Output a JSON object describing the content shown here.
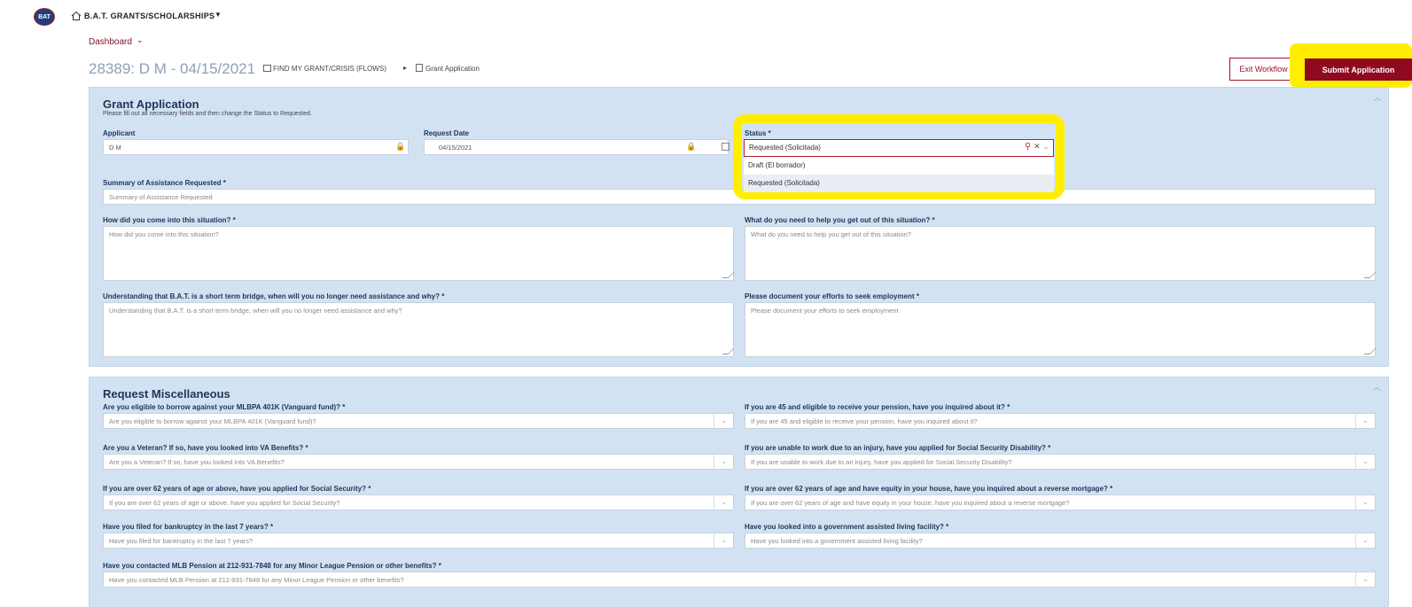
{
  "app": {
    "logo_text": "BAT",
    "title": "B.A.T. GRANTS/SCHOLARSHIPS"
  },
  "breadcrumb": {
    "label": "Dashboard"
  },
  "record": {
    "title": "28389: D M - 04/15/2021",
    "path_1": "FIND MY GRANT/CRISIS (FLOWS)",
    "path_2": "Grant Application"
  },
  "actions": {
    "exit": "Exit Workflow",
    "submit": "Submit Application"
  },
  "grant_application": {
    "title": "Grant Application",
    "subtitle": "Please fill out all necessary fields and then change the Status to Requested.",
    "applicant": {
      "label": "Applicant",
      "value": "D M"
    },
    "request_date": {
      "label": "Request Date",
      "value": "04/15/2021"
    },
    "status": {
      "label": "Status *",
      "value": "Requested (Solicitada)",
      "options": [
        "Draft (El borrador)",
        "Requested (Solicitada)"
      ]
    },
    "summary": {
      "label": "Summary of Assistance Requested *",
      "placeholder": "Summary of Assistance Requested"
    },
    "situation": {
      "label": "How did you come into this situation? *",
      "placeholder": "How did you come into this situation?"
    },
    "needs": {
      "label": "What do you need to help you get out of this situation? *",
      "placeholder": "What do you need to help you get out of this situation?"
    },
    "bridge": {
      "label": "Understanding that B.A.T. is a short term bridge, when will you no longer need assistance and why? *",
      "placeholder": "Understanding that B.A.T. is a short term bridge, when will you no longer need assistance and why?"
    },
    "employment": {
      "label": "Please document your efforts to seek employment *",
      "placeholder": "Please document your efforts to seek employment"
    }
  },
  "misc": {
    "title": "Request Miscellaneous",
    "q401k": {
      "label": "Are you eligible to borrow against your MLBPA 401K (Vanguard fund)? *",
      "placeholder": "Are you eligible to borrow against your MLBPA 401K (Vanguard fund)?"
    },
    "pension45": {
      "label": "If you are 45 and eligible to receive your pension, have you inquired about it? *",
      "placeholder": "If you are 45 and eligible to receive your pension, have you inquired about it?"
    },
    "veteran": {
      "label": "Are you a Veteran? If so, have you looked into VA Benefits? *",
      "placeholder": "Are you a Veteran? If so, have you looked into VA Benefits?"
    },
    "disability": {
      "label": "If you are unable to work due to an injury, have you applied for Social Security Disability? *",
      "placeholder": "If you are unable to work due to an injury, have you applied for Social Security Disability?"
    },
    "social_security": {
      "label": "If you are over 62 years of age or above, have you applied for Social Security? *",
      "placeholder": "If you are over 62 years of age or above, have you applied for Social Security?"
    },
    "reverse_mortgage": {
      "label": "If you are over 62 years of age and have equity in your house, have you inquired about a reverse mortgage? *",
      "placeholder": "If you are over 62 years of age and have equity in your house, have you inquired about a reverse mortgage?"
    },
    "bankruptcy": {
      "label": "Have you filed for bankruptcy in the last 7 years? *",
      "placeholder": "Have you filed for bankruptcy in the last 7 years?"
    },
    "assisted_living": {
      "label": "Have you looked into a government assisted living facility? *",
      "placeholder": "Have you looked into a government assisted living facility?"
    },
    "mlb_pension": {
      "label": "Have you contacted MLB Pension at 212-931-7848 for any Minor League Pension or other benefits? *",
      "placeholder": "Have you contacted MLB Pension at 212-931-7848 for any Minor League Pension or other benefits?"
    }
  }
}
